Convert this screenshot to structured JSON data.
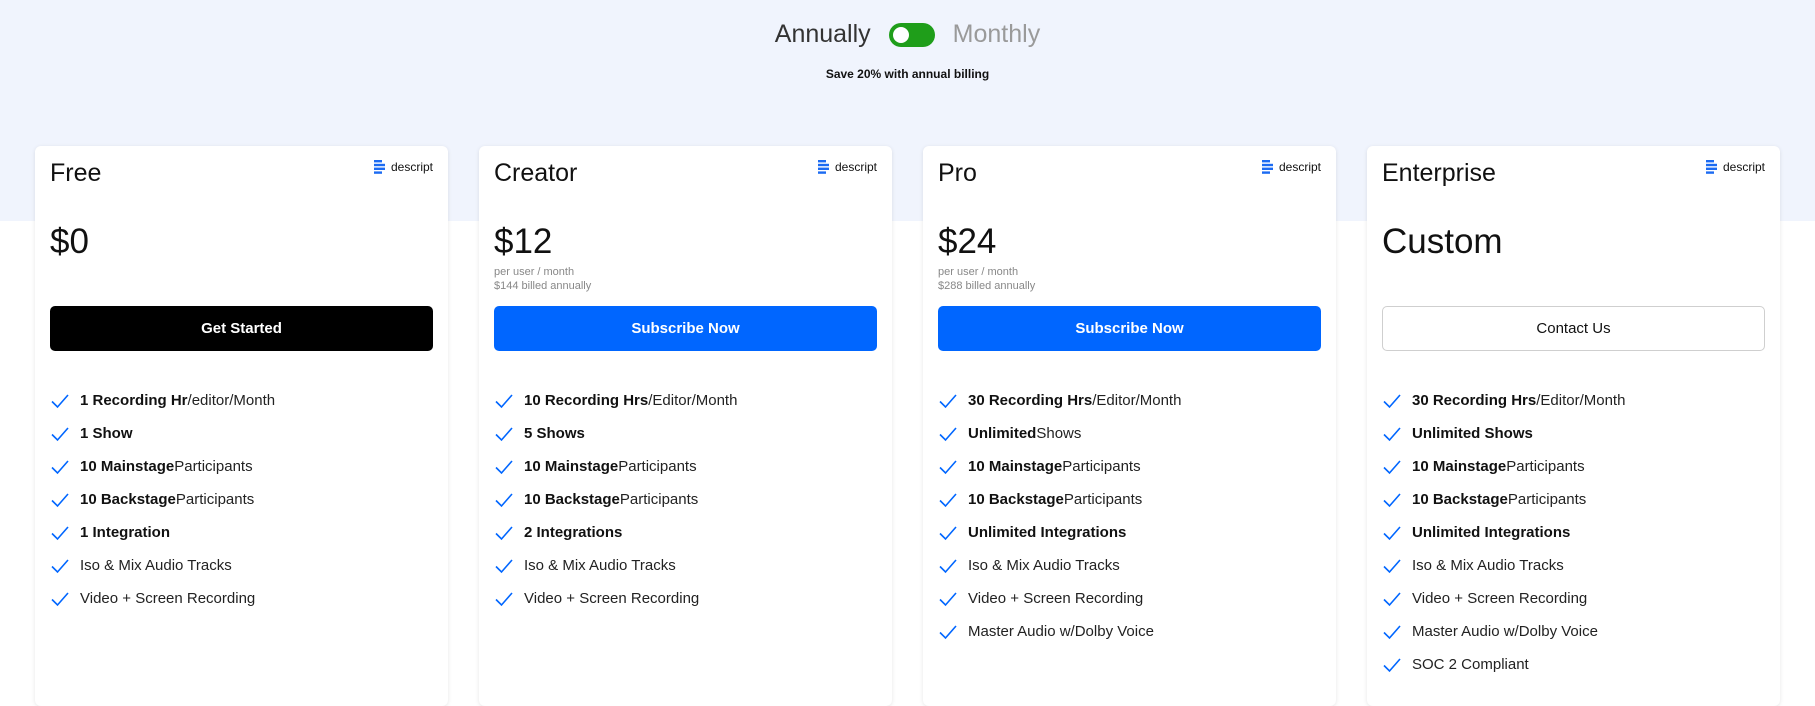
{
  "billing": {
    "annual_label": "Annually",
    "monthly_label": "Monthly",
    "save_note": "Save 20% with annual billing"
  },
  "brand": {
    "logo_text": "descript",
    "logo_icon": "descript-logo-icon"
  },
  "colors": {
    "toggle_on": "#1f9e1a",
    "accent_blue": "#0066ff",
    "check_blue": "#0066ff"
  },
  "plans": [
    {
      "name": "Free",
      "price": "$0",
      "price_sub_1": "",
      "price_sub_2": "",
      "cta": "Get Started",
      "features": [
        {
          "bold": "1 Recording Hr",
          "rest": "/editor/Month"
        },
        {
          "bold": "1 Show",
          "rest": ""
        },
        {
          "bold": "10 Mainstage",
          "rest": " Participants"
        },
        {
          "bold": "10 Backstage",
          "rest": " Participants"
        },
        {
          "bold": "1 Integration",
          "rest": ""
        },
        {
          "bold": "",
          "rest": "Iso & Mix Audio Tracks"
        },
        {
          "bold": "",
          "rest": "Video + Screen Recording"
        }
      ]
    },
    {
      "name": "Creator",
      "price": "$12",
      "price_sub_1": "per user / month",
      "price_sub_2": "$144 billed annually",
      "cta": "Subscribe Now",
      "features": [
        {
          "bold": "10 Recording Hrs",
          "rest": "/Editor/Month"
        },
        {
          "bold": "5 Shows",
          "rest": ""
        },
        {
          "bold": "10 Mainstage",
          "rest": " Participants"
        },
        {
          "bold": "10 Backstage",
          "rest": " Participants"
        },
        {
          "bold": "2 Integrations",
          "rest": ""
        },
        {
          "bold": "",
          "rest": "Iso & Mix Audio Tracks"
        },
        {
          "bold": "",
          "rest": "Video + Screen Recording"
        }
      ]
    },
    {
      "name": "Pro",
      "price": "$24",
      "price_sub_1": "per user / month",
      "price_sub_2": "$288 billed annually",
      "cta": "Subscribe Now",
      "features": [
        {
          "bold": "30 Recording Hrs",
          "rest": "/Editor/Month"
        },
        {
          "bold": "Unlimited",
          "rest": " Shows"
        },
        {
          "bold": "10 Mainstage",
          "rest": " Participants"
        },
        {
          "bold": "10 Backstage",
          "rest": " Participants"
        },
        {
          "bold": "Unlimited Integrations",
          "rest": ""
        },
        {
          "bold": "",
          "rest": "Iso & Mix Audio Tracks"
        },
        {
          "bold": "",
          "rest": "Video + Screen Recording"
        },
        {
          "bold": "",
          "rest": "Master Audio w/Dolby Voice"
        }
      ]
    },
    {
      "name": "Enterprise",
      "price": "Custom",
      "price_sub_1": "",
      "price_sub_2": "",
      "cta": "Contact Us",
      "features": [
        {
          "bold": "30 Recording Hrs",
          "rest": "/Editor/Month"
        },
        {
          "bold": "Unlimited Shows",
          "rest": ""
        },
        {
          "bold": "10 Mainstage",
          "rest": " Participants"
        },
        {
          "bold": "10 Backstage",
          "rest": " Participants"
        },
        {
          "bold": "Unlimited Integrations",
          "rest": ""
        },
        {
          "bold": "",
          "rest": "Iso & Mix Audio Tracks"
        },
        {
          "bold": "",
          "rest": "Video + Screen Recording"
        },
        {
          "bold": "",
          "rest": "Master Audio w/Dolby Voice"
        },
        {
          "bold": "",
          "rest": "SOC 2 Compliant"
        }
      ]
    }
  ]
}
